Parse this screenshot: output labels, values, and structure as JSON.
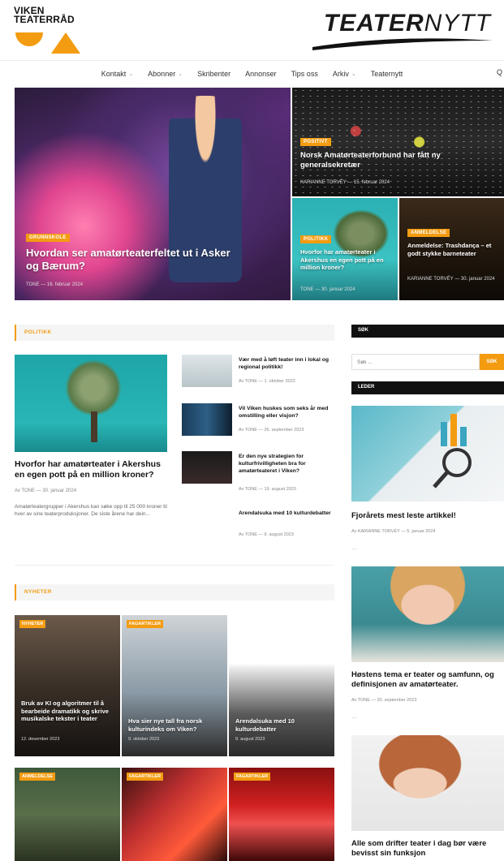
{
  "header": {
    "logo_left_line1": "VIKEN",
    "logo_left_line2": "TEATERRÅD",
    "logo_right_bold": "TEATER",
    "logo_right_light": "NYTT"
  },
  "nav": {
    "items": [
      {
        "label": "Kontakt",
        "has_menu": true
      },
      {
        "label": "Abonner",
        "has_menu": true
      },
      {
        "label": "Skribenter",
        "has_menu": false
      },
      {
        "label": "Annonser",
        "has_menu": false
      },
      {
        "label": "Tips oss",
        "has_menu": false
      },
      {
        "label": "Arkiv",
        "has_menu": true
      },
      {
        "label": "Teaternytt",
        "has_menu": false
      }
    ],
    "chevron": "⌄",
    "search_glyph": "Q"
  },
  "hero": {
    "main": {
      "category": "GRUNNSKOLE",
      "title": "Hvordan ser amatørteaterfeltet ut i Asker og Bærum?",
      "meta": "TONE — 16. februar 2024"
    },
    "top": {
      "category": "POSITIVT",
      "title": "Norsk Amatørteaterforbund har fått ny generalsekretær",
      "meta": "KARIANNE TORVÉY — 15. februar 2024"
    },
    "bottom_left": {
      "category": "POLITIKK",
      "title": "Hvorfor har amatørteater i Akershus en egen pott på en million kroner?",
      "meta": "TONE — 30. januar 2024"
    },
    "bottom_right": {
      "category": "ANMELDELSE",
      "title": "Anmeldelse: Trashdança – et godt stykke barneteater",
      "meta": "KARIANNE TORVÉY — 30. januar 2024"
    }
  },
  "politikk": {
    "section_label": "POLITIKK",
    "feature": {
      "title": "Hvorfor har amatørteater i Akershus en egen pott på en million kroner?",
      "meta": "Av TONE — 30. januar 2024",
      "excerpt": "Amatørteatergrupper i Akershus kan søke opp til 25 000 kroner til hver av sine teaterproduksjoner. De siste årene har dein..."
    },
    "list": [
      {
        "title": "Vær med å løft teater inn i lokal og regional politikk!",
        "meta": "Av TONE — 1. oktober 2023"
      },
      {
        "title": "Vil Viken huskes som seks år med omstilling eller visjon?",
        "meta": "Av TONE — 26. september 2023"
      },
      {
        "title": "Er den nye strategien for kulturfrivilligheten bra for amatørteateret i Viken?",
        "meta": "Av TONE — 19. august 2023"
      },
      {
        "title": "Arendalsuka med 10 kulturdebatter",
        "meta": "Av TONE — 9. august 2023"
      }
    ]
  },
  "nyheter": {
    "section_label": "NYHETER",
    "row1": [
      {
        "category": "NYHETER",
        "title": "Bruk av KI og algoritmer til å bearbeide dramatikk og skrive musikalske tekster i teater",
        "date": "12. desember 2023"
      },
      {
        "category": "FAGARTIKLER",
        "title": "Hva sier nye tall fra norsk kulturindeks om Viken?",
        "date": "9. oktober 2023"
      },
      {
        "category": "",
        "title": "Arendalsuka med 10 kulturdebatter",
        "date": "9. august 2023"
      }
    ],
    "row2": [
      {
        "category": "ANMELDELSE"
      },
      {
        "category": "FAGARTIKLER"
      },
      {
        "category": "FAGARTIKLER"
      }
    ]
  },
  "sidebar": {
    "search_label": "SØK",
    "search_placeholder": "Søk ...",
    "search_button": "SØK",
    "leder_label": "LEDER",
    "posts": [
      {
        "title": "Fjorårets mest leste artikkel!",
        "meta": "Av KARIANNE TORVÉY — 5. januar 2024"
      },
      {
        "title": "Høstens tema er teater og samfunn, og definisjonen av amatørteater.",
        "meta": "Av TONE — 20. september 2023"
      },
      {
        "title": "Alle som drifter teater i dag bør være bevisst sin funksjon",
        "meta": ""
      }
    ],
    "ellipsis": "..."
  },
  "colors": {
    "accent": "#f39c12",
    "dark": "#111111"
  }
}
